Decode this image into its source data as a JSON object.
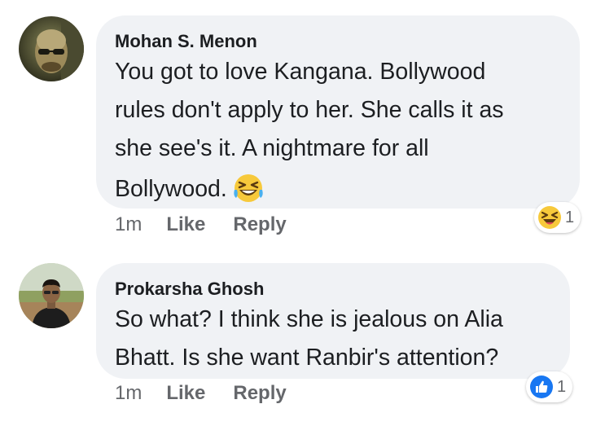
{
  "comments": [
    {
      "author": "Mohan S. Menon",
      "lines": [
        "You got to love Kangana. Bollywood",
        "rules don't apply to her. She calls it as",
        "she see's it. A nightmare for all",
        "Bollywood."
      ],
      "emoji": "laughing-tears-emoji",
      "time": "1m",
      "like_label": "Like",
      "reply_label": "Reply",
      "reaction": {
        "icon": "haha-reaction-icon",
        "count": "1"
      }
    },
    {
      "author": "Prokarsha Ghosh",
      "lines": [
        "So what? I think she is jealous on Alia",
        "Bhatt. Is she want Ranbir's attention?"
      ],
      "time": "1m",
      "like_label": "Like",
      "reply_label": "Reply",
      "reaction": {
        "icon": "like-reaction-icon",
        "count": "1"
      }
    }
  ],
  "colors": {
    "bubble": "#f0f2f5",
    "text": "#1c1e21",
    "meta": "#65676b",
    "like_blue": "#1877f2",
    "haha_yellow": "#f7c93b"
  }
}
